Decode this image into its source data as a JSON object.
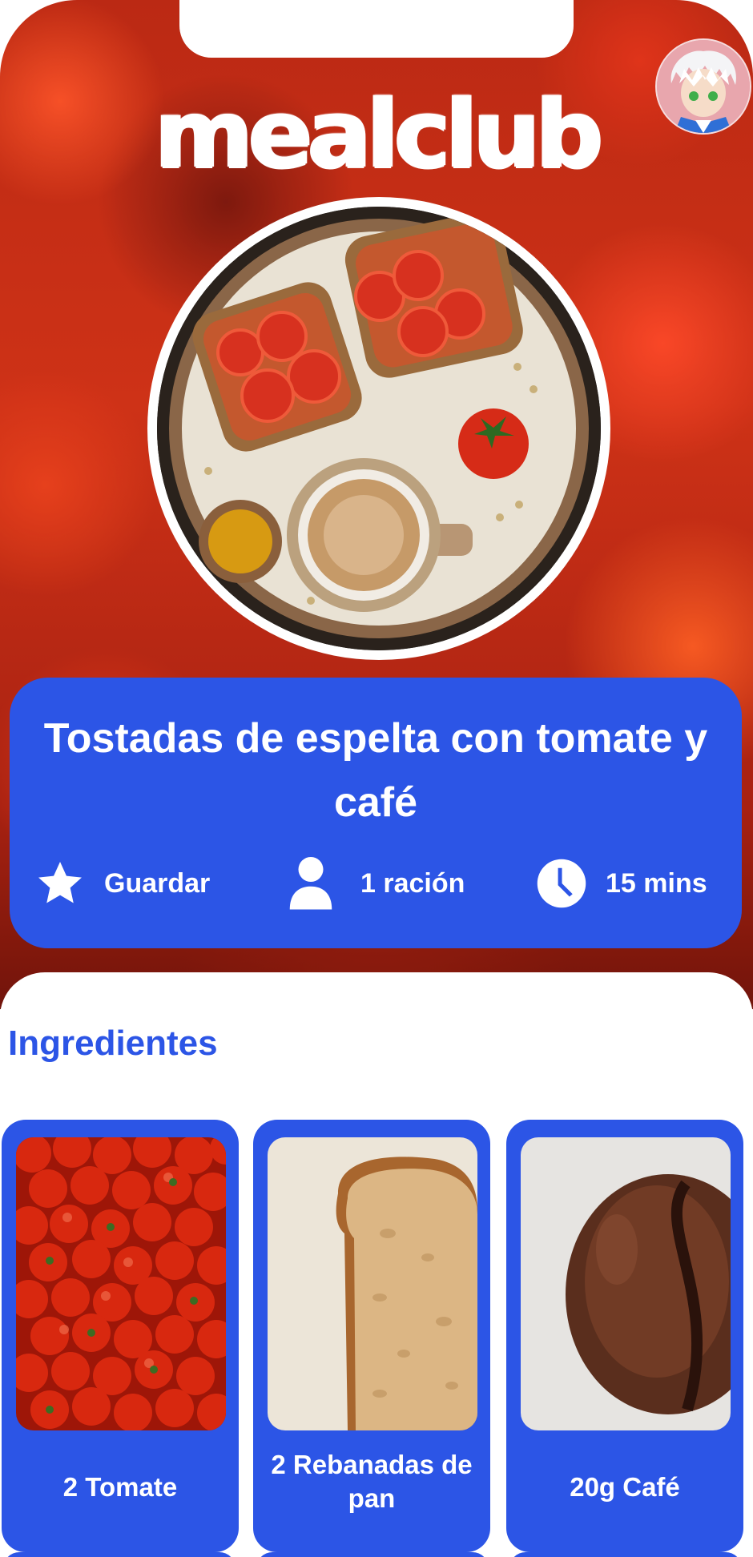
{
  "app": {
    "logo": "mealclub"
  },
  "header": {
    "avatar": "user-avatar"
  },
  "recipe": {
    "title": "Tostadas de espelta con tomate y café",
    "save_label": "Guardar",
    "servings_label": "1 ración",
    "time_label": "15 mins"
  },
  "ingredients": {
    "heading": "Ingredientes",
    "items": [
      {
        "label": "2 Tomate",
        "image": "tomatoes-photo"
      },
      {
        "label": "2 Rebanadas de pan",
        "image": "bread-slice-photo"
      },
      {
        "label": "20g Café",
        "image": "coffee-bean-photo"
      }
    ]
  },
  "colors": {
    "brand_blue": "#2c55e6",
    "tomato_red": "#d53a1c",
    "white": "#ffffff"
  },
  "icons": [
    "star-icon",
    "person-icon",
    "clock-icon"
  ]
}
